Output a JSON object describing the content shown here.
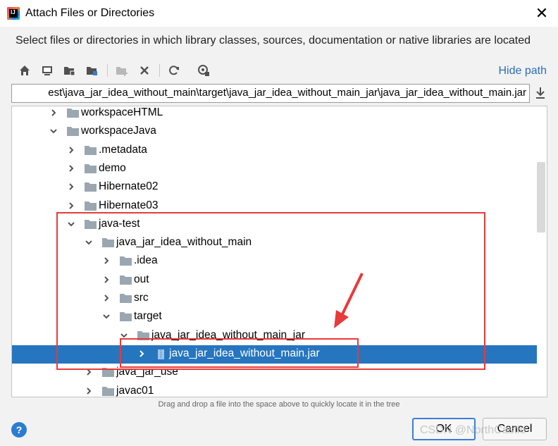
{
  "window": {
    "title": "Attach Files or Directories",
    "app_icon_text": "IJ",
    "close_icon": "close-icon"
  },
  "description": "Select files or directories in which library classes, sources, documentation or native libraries are located",
  "toolbar": {
    "icons": [
      "home-icon",
      "desktop-icon",
      "project-folder-icon",
      "module-folder-icon",
      "new-folder-icon",
      "delete-icon",
      "refresh-icon",
      "show-hidden-icon"
    ],
    "hide_path_label": "Hide path"
  },
  "path_field": {
    "value": "est\\java_jar_idea_without_main\\target\\java_jar_idea_without_main_jar\\java_jar_idea_without_main.jar"
  },
  "tree": {
    "rows": [
      {
        "label": "workspaceHTML",
        "depth": 0,
        "expanded": false
      },
      {
        "label": "workspaceJava",
        "depth": 0,
        "expanded": true
      },
      {
        "label": ".metadata",
        "depth": 1,
        "expanded": false
      },
      {
        "label": "demo",
        "depth": 1,
        "expanded": false
      },
      {
        "label": "Hibernate02",
        "depth": 1,
        "expanded": false
      },
      {
        "label": "Hibernate03",
        "depth": 1,
        "expanded": false
      },
      {
        "label": "java-test",
        "depth": 1,
        "expanded": true
      },
      {
        "label": "java_jar_idea_without_main",
        "depth": 2,
        "expanded": true
      },
      {
        "label": ".idea",
        "depth": 3,
        "expanded": false
      },
      {
        "label": "out",
        "depth": 3,
        "expanded": false
      },
      {
        "label": "src",
        "depth": 3,
        "expanded": false
      },
      {
        "label": "target",
        "depth": 3,
        "expanded": true
      },
      {
        "label": "java_jar_idea_without_main_jar",
        "depth": 4,
        "expanded": true
      },
      {
        "label": "java_jar_idea_without_main.jar",
        "depth": 5,
        "expanded": false,
        "type": "jar",
        "selected": true
      },
      {
        "label": "java_jar_use",
        "depth": 2,
        "expanded": false
      },
      {
        "label": "javac01",
        "depth": 2,
        "expanded": false
      }
    ]
  },
  "hint": "Drag and drop a file into the space above to quickly locate it in the tree",
  "buttons": {
    "ok": "OK",
    "cancel": "Cancel",
    "help": "?"
  },
  "watermark": "CSDN @NorthCastle",
  "colors": {
    "selection": "#2675bf",
    "link": "#2b6db5",
    "annotation": "#e83a3a",
    "folder": "#9aa7b0"
  }
}
